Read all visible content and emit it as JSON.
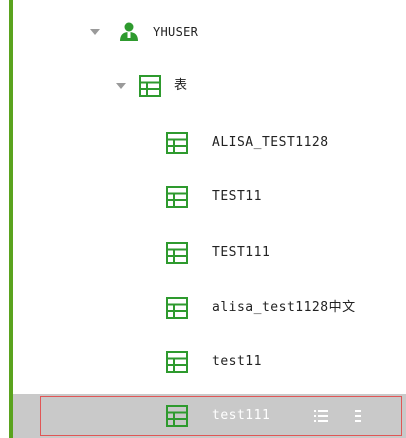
{
  "tree": {
    "user_node": {
      "label": "YHUSER",
      "expanded": true,
      "icon": "user-icon"
    },
    "category_node": {
      "label": "表",
      "expanded": true,
      "icon": "table-icon"
    },
    "tables": [
      {
        "label": "ALISA_TEST1128",
        "icon": "table-icon"
      },
      {
        "label": "TEST11",
        "icon": "table-icon"
      },
      {
        "label": "TEST111",
        "icon": "table-icon"
      },
      {
        "label": "alisa_test1128中文",
        "icon": "table-icon"
      },
      {
        "label": "test11",
        "icon": "table-icon"
      },
      {
        "label": "test111",
        "icon": "table-icon",
        "selected": true
      }
    ],
    "selected_row_actions": [
      "list-icon",
      "menu-icon"
    ]
  },
  "colors": {
    "accent": "#5aa31e",
    "icon_green": "#2e9a2e",
    "selected_bg": "#c9c9c9",
    "selected_outline": "#e05656"
  }
}
